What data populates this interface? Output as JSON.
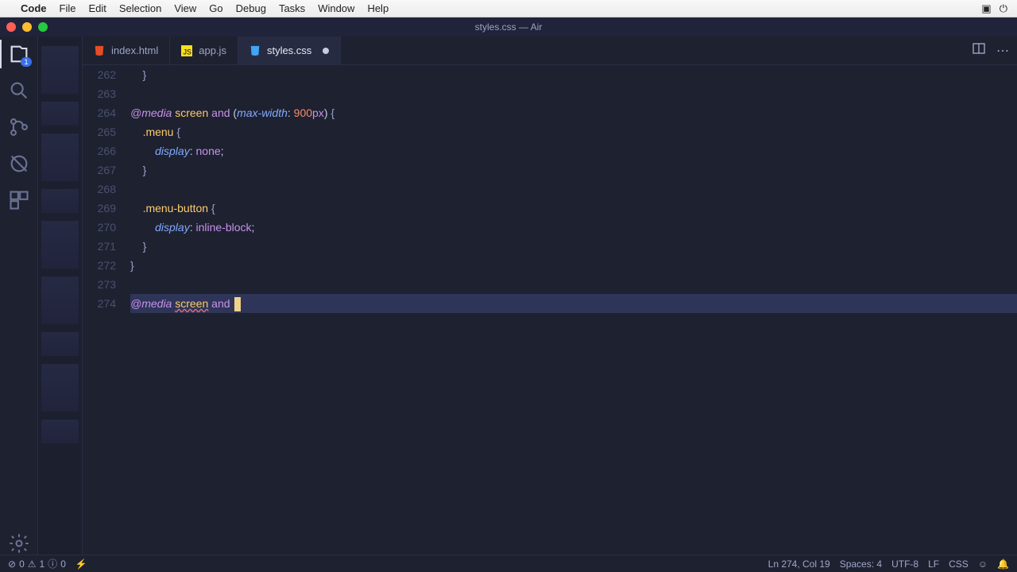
{
  "macos": {
    "app": "Code",
    "menus": [
      "File",
      "Edit",
      "Selection",
      "View",
      "Go",
      "Debug",
      "Tasks",
      "Window",
      "Help"
    ]
  },
  "titlebar": {
    "title": "styles.css — Air"
  },
  "activitybar": {
    "badge": "1"
  },
  "tabs": [
    {
      "label": "index.html",
      "icon": "html",
      "active": false,
      "dirty": false
    },
    {
      "label": "app.js",
      "icon": "js",
      "active": false,
      "dirty": false
    },
    {
      "label": "styles.css",
      "icon": "css",
      "active": true,
      "dirty": true
    }
  ],
  "editor": {
    "startLine": 262,
    "lines": [
      {
        "n": 262,
        "segs": [
          {
            "t": "    }",
            "c": "brace"
          }
        ]
      },
      {
        "n": 263,
        "segs": []
      },
      {
        "n": 264,
        "segs": [
          {
            "t": "@media",
            "c": "at"
          },
          {
            "t": " "
          },
          {
            "t": "screen",
            "c": "screen"
          },
          {
            "t": " "
          },
          {
            "t": "and",
            "c": "kw"
          },
          {
            "t": " ("
          },
          {
            "t": "max-width",
            "c": "prop"
          },
          {
            "t": ": "
          },
          {
            "t": "900",
            "c": "num"
          },
          {
            "t": "px",
            "c": "unit"
          },
          {
            "t": ") "
          },
          {
            "t": "{",
            "c": "brace"
          }
        ]
      },
      {
        "n": 265,
        "segs": [
          {
            "t": "    "
          },
          {
            "t": ".menu",
            "c": "sel"
          },
          {
            "t": " "
          },
          {
            "t": "{",
            "c": "brace"
          }
        ]
      },
      {
        "n": 266,
        "segs": [
          {
            "t": "        "
          },
          {
            "t": "display",
            "c": "prop"
          },
          {
            "t": ": "
          },
          {
            "t": "none",
            "c": "val"
          },
          {
            "t": ";"
          }
        ]
      },
      {
        "n": 267,
        "segs": [
          {
            "t": "    "
          },
          {
            "t": "}",
            "c": "brace"
          }
        ]
      },
      {
        "n": 268,
        "segs": []
      },
      {
        "n": 269,
        "segs": [
          {
            "t": "    "
          },
          {
            "t": ".menu-button",
            "c": "sel"
          },
          {
            "t": " "
          },
          {
            "t": "{",
            "c": "brace"
          }
        ]
      },
      {
        "n": 270,
        "segs": [
          {
            "t": "        "
          },
          {
            "t": "display",
            "c": "prop"
          },
          {
            "t": ": "
          },
          {
            "t": "inline-block",
            "c": "val"
          },
          {
            "t": ";"
          }
        ]
      },
      {
        "n": 271,
        "segs": [
          {
            "t": "    "
          },
          {
            "t": "}",
            "c": "brace"
          }
        ]
      },
      {
        "n": 272,
        "segs": [
          {
            "t": "}",
            "c": "brace"
          }
        ]
      },
      {
        "n": 273,
        "segs": []
      },
      {
        "n": 274,
        "hl": true,
        "cursor": true,
        "segs": [
          {
            "t": "@media",
            "c": "at"
          },
          {
            "t": " "
          },
          {
            "t": "screen",
            "c": "screen",
            "err": true
          },
          {
            "t": " "
          },
          {
            "t": "and",
            "c": "kw"
          },
          {
            "t": " "
          }
        ]
      }
    ]
  },
  "status": {
    "errors": "0",
    "warnings": "1",
    "info": "0",
    "cursor": "Ln 274, Col 19",
    "indent": "Spaces: 4",
    "encoding": "UTF-8",
    "eol": "LF",
    "language": "CSS"
  }
}
